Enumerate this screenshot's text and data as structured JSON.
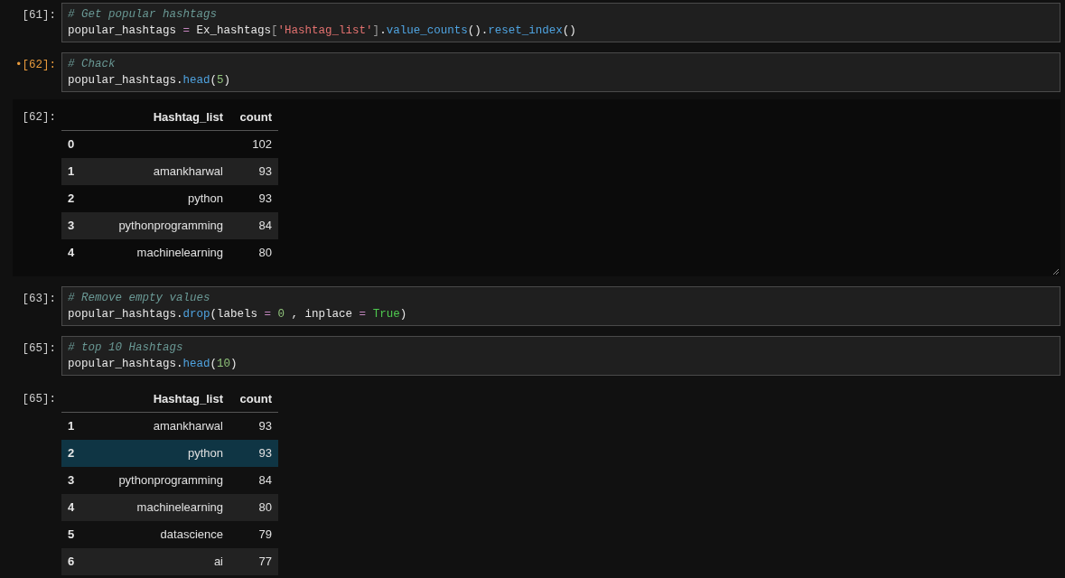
{
  "cells": [
    {
      "kind": "code",
      "prompt": "[61]:",
      "modified": false,
      "lines": [
        [
          {
            "t": "# Get popular hashtags",
            "kind": "comment"
          }
        ],
        [
          {
            "t": "popular_hashtags ",
            "kind": "plain"
          },
          {
            "t": "= ",
            "kind": "operator"
          },
          {
            "t": "Ex_hashtags",
            "kind": "plain"
          },
          {
            "t": "[",
            "kind": "bracket"
          },
          {
            "t": "'Hashtag_list'",
            "kind": "string"
          },
          {
            "t": "]",
            "kind": "bracket"
          },
          {
            "t": ".",
            "kind": "plain"
          },
          {
            "t": "value_counts",
            "kind": "function"
          },
          {
            "t": "().",
            "kind": "plain"
          },
          {
            "t": "reset_index",
            "kind": "function"
          },
          {
            "t": "()",
            "kind": "plain"
          }
        ]
      ]
    },
    {
      "kind": "code",
      "prompt": "•[62]:",
      "modified": true,
      "lines": [
        [
          {
            "t": "# Chack",
            "kind": "comment"
          }
        ],
        [
          {
            "t": "popular_hashtags.",
            "kind": "plain"
          },
          {
            "t": "head",
            "kind": "function"
          },
          {
            "t": "(",
            "kind": "plain"
          },
          {
            "t": "5",
            "kind": "number"
          },
          {
            "t": ")",
            "kind": "plain"
          }
        ]
      ]
    },
    {
      "kind": "output",
      "prompt": "[62]:",
      "framed": true,
      "columns": [
        "Hashtag_list",
        "count"
      ],
      "rows": [
        {
          "index": "0",
          "count": "102",
          "selected": false
        },
        {
          "index": "1",
          "hashtag": "amankharwal",
          "count": "93",
          "selected": false
        },
        {
          "index": "2",
          "hashtag": "python",
          "count": "93",
          "selected": false
        },
        {
          "index": "3",
          "hashtag": "pythonprogramming",
          "count": "84",
          "selected": false
        },
        {
          "index": "4",
          "hashtag": "machinelearning",
          "count": "80",
          "selected": false
        }
      ]
    },
    {
      "kind": "code",
      "prompt": "[63]:",
      "modified": false,
      "lines": [
        [
          {
            "t": "# Remove empty values",
            "kind": "comment"
          }
        ],
        [
          {
            "t": "popular_hashtags.",
            "kind": "plain"
          },
          {
            "t": "drop",
            "kind": "function"
          },
          {
            "t": "(labels ",
            "kind": "plain"
          },
          {
            "t": "= ",
            "kind": "operator"
          },
          {
            "t": "0",
            "kind": "number"
          },
          {
            "t": " , inplace ",
            "kind": "plain"
          },
          {
            "t": "= ",
            "kind": "operator"
          },
          {
            "t": "True",
            "kind": "keyword"
          },
          {
            "t": ")",
            "kind": "plain"
          }
        ]
      ]
    },
    {
      "kind": "code",
      "prompt": "[65]:",
      "modified": false,
      "lines": [
        [
          {
            "t": "# top 10 Hashtags",
            "kind": "comment"
          }
        ],
        [
          {
            "t": "popular_hashtags.",
            "kind": "plain"
          },
          {
            "t": "head",
            "kind": "function"
          },
          {
            "t": "(",
            "kind": "plain"
          },
          {
            "t": "10",
            "kind": "number"
          },
          {
            "t": ")",
            "kind": "plain"
          }
        ]
      ]
    },
    {
      "kind": "output",
      "prompt": "[65]:",
      "framed": false,
      "columns": [
        "Hashtag_list",
        "count"
      ],
      "rows": [
        {
          "index": "1",
          "hashtag": "amankharwal",
          "count": "93",
          "selected": false
        },
        {
          "index": "2",
          "hashtag": "python",
          "count": "93",
          "selected": true
        },
        {
          "index": "3",
          "hashtag": "pythonprogramming",
          "count": "84",
          "selected": false
        },
        {
          "index": "4",
          "hashtag": "machinelearning",
          "count": "80",
          "selected": false
        },
        {
          "index": "5",
          "hashtag": "datascience",
          "count": "79",
          "selected": false
        },
        {
          "index": "6",
          "hashtag": "ai",
          "count": "77",
          "selected": false
        }
      ]
    }
  ]
}
